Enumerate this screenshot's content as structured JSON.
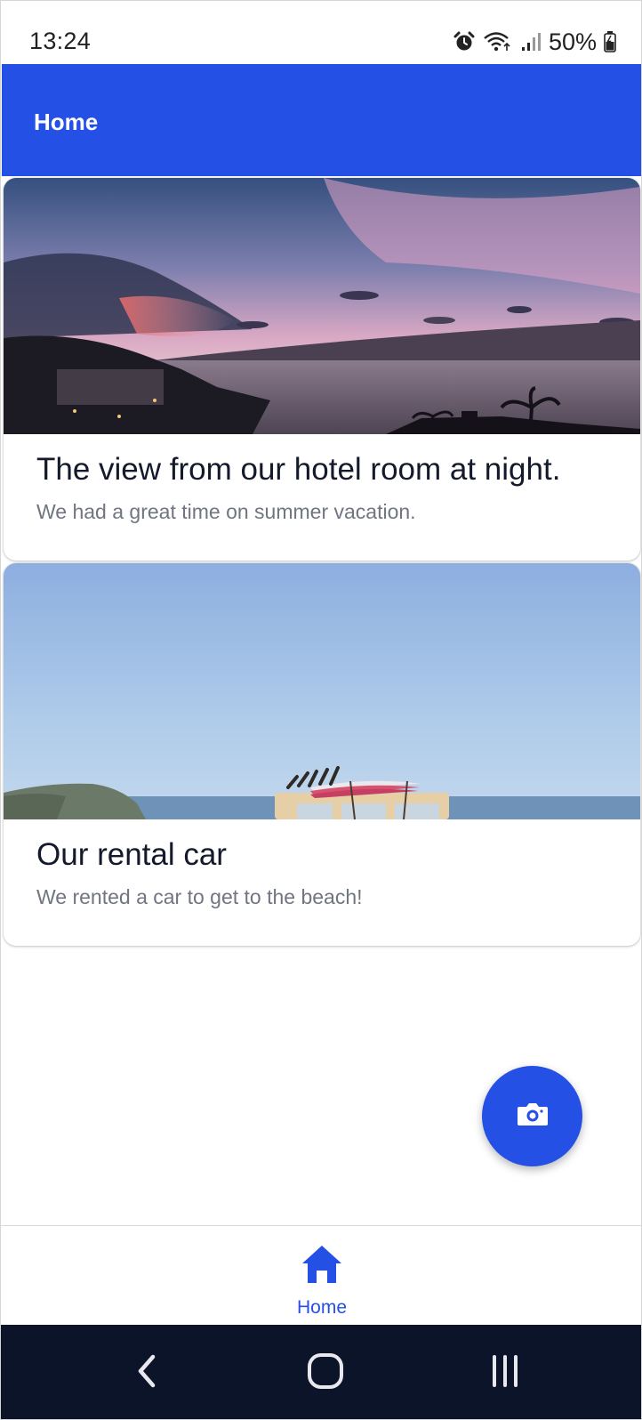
{
  "status_bar": {
    "time": "13:24",
    "battery": "50%",
    "icons": [
      "alarm-icon",
      "wifi-icon",
      "signal-icon",
      "battery-icon"
    ]
  },
  "app_bar": {
    "title": "Home",
    "color": "#2450e6"
  },
  "posts": [
    {
      "title": "The view from our hotel room at night.",
      "description": "We had a great time on summer vacation.",
      "image": "sunset-sea-photo"
    },
    {
      "title": "Our rental car",
      "description": "We rented a car to get to the beach!",
      "image": "car-with-surfboards-photo"
    }
  ],
  "fab": {
    "icon": "camera-icon"
  },
  "bottom_nav": {
    "items": [
      {
        "label": "Home",
        "icon": "home-icon",
        "active": true
      }
    ]
  },
  "system_nav": {
    "buttons": [
      "back-icon",
      "home-circle-icon",
      "recents-icon"
    ]
  }
}
